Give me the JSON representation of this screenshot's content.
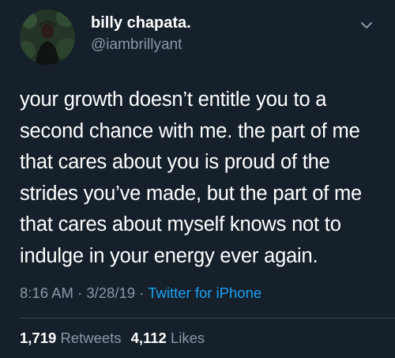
{
  "tweet": {
    "author": {
      "display_name": "billy chapata.",
      "handle": "@iambrillyant",
      "avatar_icon": "profile-photo"
    },
    "menu_icon": "chevron-down-icon",
    "body_lines": [
      "your growth doesn’t entitle you to a",
      "second chance with me. the part of me",
      "that cares about you is proud of the",
      "strides you’ve made, but the part of me",
      "that cares about myself knows not to",
      "indulge in your energy ever again."
    ],
    "meta": {
      "time": "8:16 AM",
      "date": "3/28/19",
      "separator": "·",
      "source": "Twitter for iPhone"
    },
    "stats": {
      "retweets_count": "1,719",
      "retweets_label": "Retweets",
      "likes_count": "4,112",
      "likes_label": "Likes"
    }
  },
  "colors": {
    "background": "#15202b",
    "primary_text": "#ffffff",
    "secondary_text": "#8899a6",
    "link": "#1da1f2",
    "divider": "#38444d"
  }
}
